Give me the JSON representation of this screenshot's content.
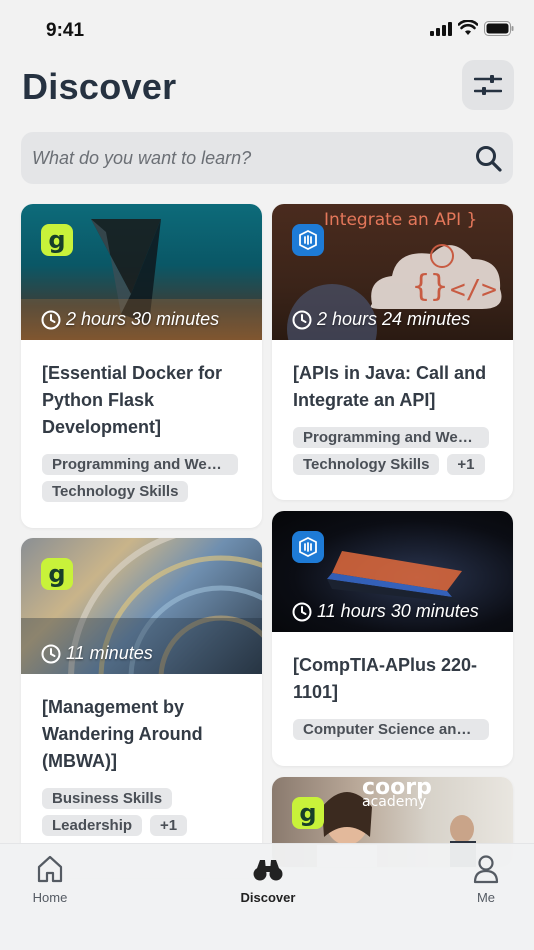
{
  "status_bar": {
    "time": "9:41"
  },
  "header": {
    "title": "Discover"
  },
  "search": {
    "placeholder": "What do you want to learn?"
  },
  "cards": [
    {
      "title": "[Essential Docker for Python Flask Development]",
      "duration": "2 hours 30 minutes",
      "provider_badge": "g",
      "tags": [
        "Programming and Web...",
        "Technology Skills"
      ]
    },
    {
      "title": "[APIs in Java: Call and Integrate an API]",
      "duration": "2 hours 24 minutes",
      "provider_badge": "udemy-business-icon",
      "thumb_text": "Integrate an API }",
      "tags": [
        "Programming and Web...",
        "Technology Skills",
        "+1"
      ]
    },
    {
      "title": "[Management by Wandering Around (MBWA)]",
      "duration": "11 minutes",
      "provider_badge": "g",
      "tags": [
        "Business Skills",
        "Leadership",
        "+1"
      ]
    },
    {
      "title": "[CompTIA-APlus 220-1101]",
      "duration": "11 hours 30 minutes",
      "provider_badge": "udemy-business-icon",
      "tags": [
        "Computer Science and ..."
      ]
    },
    {
      "provider_badge": "g",
      "thumb_text_1": "coorp",
      "thumb_text_2": "academy"
    }
  ],
  "tabbar": {
    "home": "Home",
    "discover": "Discover",
    "me": "Me"
  },
  "colors": {
    "background": "#f2f2f2",
    "accent_green": "#c8f23a",
    "badge_blue": "#1e7bd6",
    "tag_bg": "#e6e7e9"
  }
}
